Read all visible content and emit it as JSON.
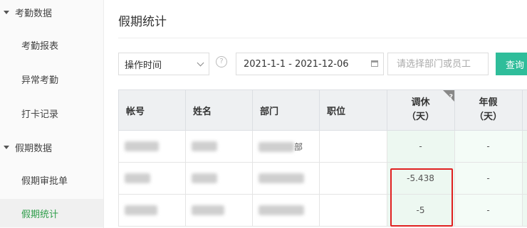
{
  "sidebar": {
    "groups": [
      {
        "label": "考勤数据",
        "items": [
          "考勤报表",
          "异常考勤",
          "打卡记录"
        ]
      },
      {
        "label": "假期数据",
        "items": [
          "假期审批单",
          "假期统计"
        ]
      }
    ],
    "active_item": "假期统计"
  },
  "header": {
    "title": "假期统计"
  },
  "filters": {
    "time_select": "操作时间",
    "help_icon": "question-icon",
    "date_range": "2021-1-1 - 2021-12-06",
    "dept_placeholder": "请选择部门或员工",
    "query_label": "查询"
  },
  "table": {
    "headers": {
      "account": "帐号",
      "name": "姓名",
      "dept": "部门",
      "position": "职位",
      "comp_leave": "调休",
      "comp_leave_unit": "（天）",
      "annual_leave": "年假",
      "annual_leave_unit": "（天）"
    },
    "rows": [
      {
        "dept_suffix": "部",
        "comp_leave": "-",
        "annual_leave": "-"
      },
      {
        "dept_suffix": "",
        "comp_leave": "-5.438",
        "annual_leave": "-"
      },
      {
        "dept_suffix": "",
        "comp_leave": "-5",
        "annual_leave": "-"
      }
    ]
  },
  "colors": {
    "accent_green": "#2e9d4a",
    "query_button": "#2fbd9a",
    "highlight_box": "#e02020"
  }
}
